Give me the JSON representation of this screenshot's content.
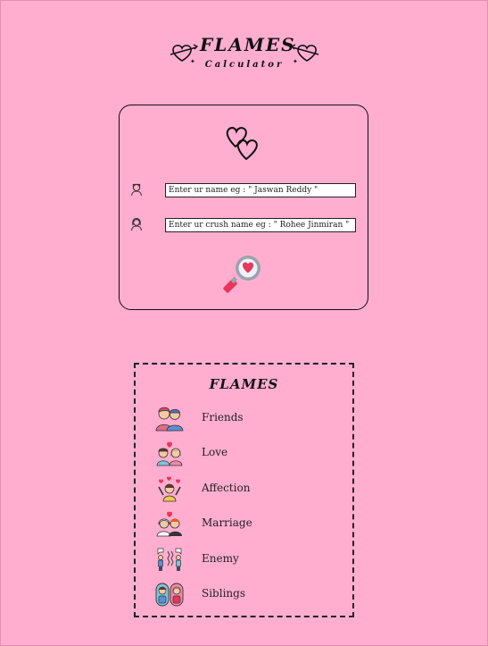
{
  "header": {
    "title": "FLAMES",
    "subtitle": "Calculator"
  },
  "form": {
    "name_placeholder": "Enter ur name eg : \" Jaswan Reddy \"",
    "crush_placeholder": "Enter ur crush name eg : \" Rohee Jinmiran \""
  },
  "legend": {
    "title": "FLAMES",
    "items": [
      {
        "label": "Friends",
        "icon": "friends-icon"
      },
      {
        "label": "Love",
        "icon": "love-couple-icon"
      },
      {
        "label": "Affection",
        "icon": "affection-icon"
      },
      {
        "label": "Marriage",
        "icon": "marriage-icon"
      },
      {
        "label": "Enemy",
        "icon": "enemy-icon"
      },
      {
        "label": "Siblings",
        "icon": "siblings-icon"
      }
    ]
  },
  "colors": {
    "background": "#ffaecf",
    "heart": "#e8365d"
  }
}
